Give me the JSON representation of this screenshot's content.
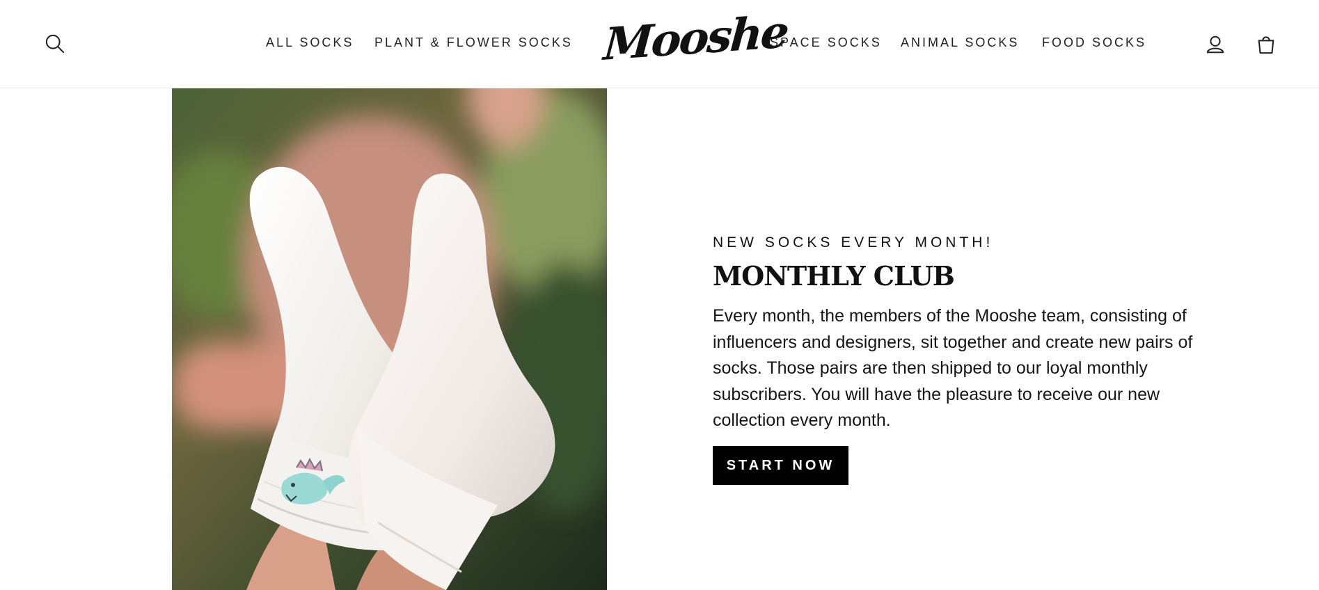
{
  "header": {
    "logo_text": "Mooshe",
    "nav_left": [
      {
        "label": "ALL SOCKS"
      },
      {
        "label": "PLANT & FLOWER SOCKS"
      }
    ],
    "nav_right": [
      {
        "label": "SPACE SOCKS"
      },
      {
        "label": "ANIMAL SOCKS"
      },
      {
        "label": "FOOD SOCKS"
      }
    ],
    "icons": {
      "search": "search-icon",
      "account": "user-icon",
      "cart": "shopping-bag-icon"
    }
  },
  "hero": {
    "image_alt": "white socks with dinosaur embroidery",
    "eyebrow": "NEW SOCKS EVERY MONTH!",
    "title": "MONTHLY CLUB",
    "description": "Every month, the members of the Mooshe team, consisting of influencers and designers, sit together and create new pairs of socks. Those pairs are then shipped to our loyal monthly subscribers. You will have the pleasure to receive our new collection every month.",
    "cta_label": "START NOW"
  },
  "colors": {
    "text": "#111111",
    "background": "#ffffff",
    "button": "#000000",
    "button_text": "#ffffff"
  }
}
